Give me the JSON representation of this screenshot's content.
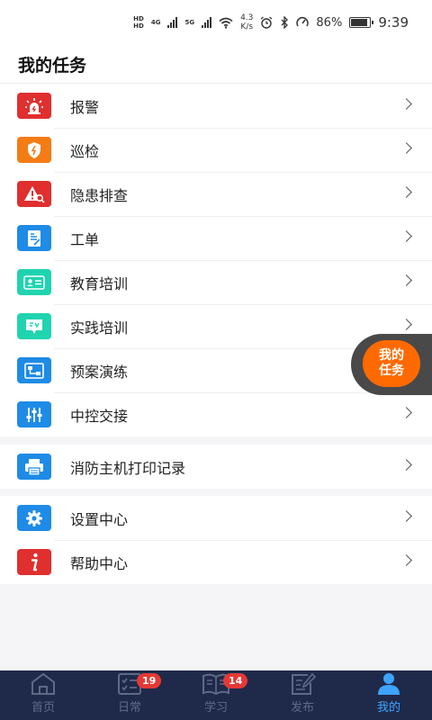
{
  "status_bar": {
    "net1": "HD",
    "net2": "HD",
    "gen1": "4G",
    "gen2": "5G",
    "speed_value": "4.3",
    "speed_unit": "K/s",
    "battery": "86%",
    "time": "9:39"
  },
  "header": {
    "title": "我的任务"
  },
  "task_items": [
    {
      "label": "报警",
      "color": "#e02f2f",
      "icon": "alarm-light-icon"
    },
    {
      "label": "巡检",
      "color": "#f47c15",
      "icon": "shield-icon"
    },
    {
      "label": "隐患排查",
      "color": "#e02f2f",
      "icon": "warning-search-icon"
    },
    {
      "label": "工单",
      "color": "#1e8be6",
      "icon": "document-icon"
    },
    {
      "label": "教育培训",
      "color": "#20d4b0",
      "icon": "id-card-icon"
    },
    {
      "label": "实践培训",
      "color": "#20d4b0",
      "icon": "chat-bubble-icon"
    },
    {
      "label": "预案演练",
      "color": "#1e8be6",
      "icon": "flowchart-icon"
    },
    {
      "label": "中控交接",
      "color": "#1e8be6",
      "icon": "sliders-icon"
    }
  ],
  "print_item": {
    "label": "消防主机打印记录",
    "color": "#1e8be6",
    "icon": "printer-icon"
  },
  "help_items": [
    {
      "label": "设置中心",
      "color": "#1e8be6",
      "icon": "gear-icon"
    },
    {
      "label": "帮助中心",
      "color": "#e02f2f",
      "icon": "info-icon"
    }
  ],
  "float_button": {
    "line1": "我的",
    "line2": "任务"
  },
  "tabbar": [
    {
      "label": "首页",
      "icon": "home-icon",
      "badge": ""
    },
    {
      "label": "日常",
      "icon": "daily-checklist-icon",
      "badge": "19"
    },
    {
      "label": "学习",
      "icon": "book-icon",
      "badge": "14"
    },
    {
      "label": "发布",
      "icon": "edit-icon",
      "badge": ""
    },
    {
      "label": "我的",
      "icon": "user-icon",
      "badge": "",
      "active": true
    }
  ]
}
